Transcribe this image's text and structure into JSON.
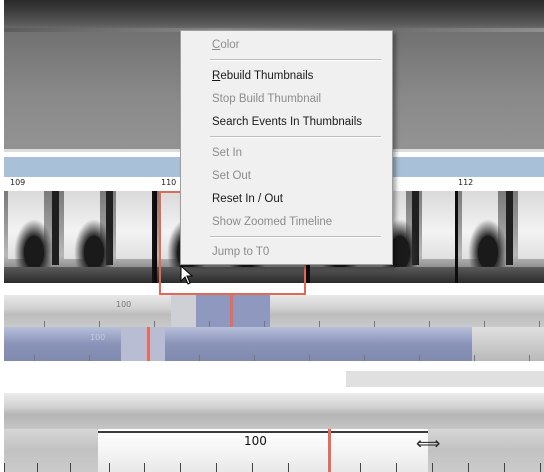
{
  "frame_numbers": [
    "109",
    "110",
    "112"
  ],
  "timeline": {
    "track1_label": "100",
    "track2_label": "100",
    "track4_label": "100"
  },
  "context_menu": {
    "items": [
      {
        "label": "Color",
        "mnemonic": "C",
        "rest": "olor",
        "enabled": false
      },
      {
        "label": "Rebuild Thumbnails",
        "mnemonic": "R",
        "rest": "ebuild Thumbnails",
        "enabled": true
      },
      {
        "label": "Stop Build Thumbnail",
        "enabled": false
      },
      {
        "label": "Search Events In Thumbnails",
        "enabled": true
      },
      {
        "label": "Set In",
        "enabled": false
      },
      {
        "label": "Set Out",
        "enabled": false
      },
      {
        "label": "Reset In / Out",
        "enabled": true
      },
      {
        "label": "Show Zoomed Timeline",
        "enabled": false
      },
      {
        "label": "Jump to T0",
        "enabled": false
      }
    ]
  },
  "colors": {
    "cursor": "#e86a5a",
    "selection": "#8f99bf",
    "header_strip": "#a8c0d8"
  },
  "icons": [
    "mouse-pointer-icon",
    "resize-horizontal-icon"
  ]
}
